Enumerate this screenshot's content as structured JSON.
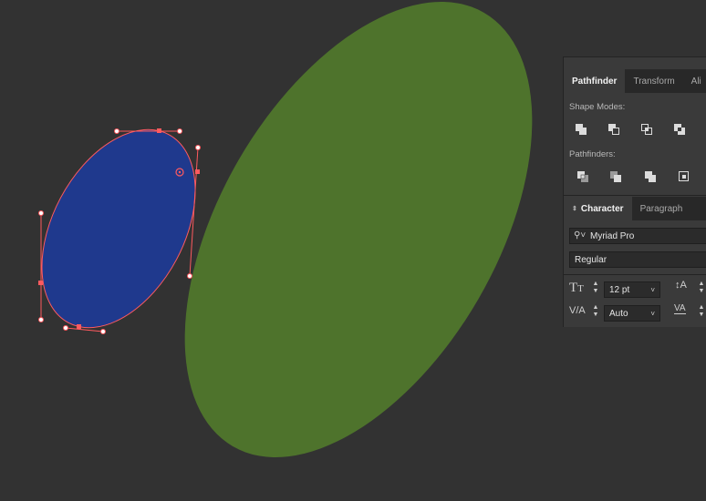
{
  "colors": {
    "canvas": "#323232",
    "green_shape": "#4e732c",
    "blue_shape": "#1f398d",
    "selection": "#ff5a5f"
  },
  "canvas": {
    "shapes": [
      {
        "name": "green-ellipse",
        "fill": "#4e732c"
      },
      {
        "name": "blue-ellipse",
        "fill": "#1f398d",
        "selected": true
      }
    ]
  },
  "panel_pathfinder": {
    "tabs": [
      {
        "label": "Pathfinder",
        "active": true
      },
      {
        "label": "Transform",
        "active": false
      },
      {
        "label": "Ali",
        "active": false
      }
    ],
    "shape_modes_label": "Shape Modes:",
    "shape_modes": [
      "unite-icon",
      "minus-front-icon",
      "intersect-icon",
      "exclude-icon"
    ],
    "pathfinders_label": "Pathfinders:",
    "pathfinders": [
      "divide-icon",
      "trim-icon",
      "merge-icon",
      "crop-icon"
    ]
  },
  "panel_character": {
    "tabs": [
      {
        "label": "Character",
        "active": true
      },
      {
        "label": "Paragraph",
        "active": false
      }
    ],
    "font_family": "Myriad Pro",
    "font_style": "Regular",
    "font_size": "12 pt",
    "kerning": "Auto"
  }
}
